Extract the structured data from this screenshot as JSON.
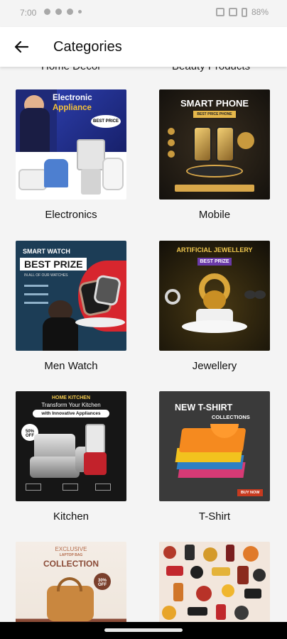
{
  "status": {
    "time": "7:00",
    "battery": "88%"
  },
  "appbar": {
    "title": "Categories"
  },
  "partial_top": [
    "Home Decor",
    "Beauty Products"
  ],
  "categories": [
    {
      "label": "Electronics",
      "banner": [
        "Electronic",
        "Appliance",
        "BEST PRICE"
      ]
    },
    {
      "label": "Mobile",
      "banner": [
        "SMART PHONE",
        "BEST PRICE PHONE"
      ]
    },
    {
      "label": "Men Watch",
      "banner": [
        "SMART WATCH",
        "BEST PRIZE",
        "IN ALL OF OUR WATCHES"
      ]
    },
    {
      "label": "Jewellery",
      "banner": [
        "ARTIFICIAL JEWELLERY",
        "BEST PRIZE"
      ]
    },
    {
      "label": "Kitchen",
      "banner": [
        "HOME KITCHEN",
        "Transform Your Kitchen",
        "with Innovative Appliances",
        "50% OFF"
      ]
    },
    {
      "label": "T-Shirt",
      "banner": [
        "NEW T-SHIRT",
        "COLLECTIONS",
        "BUY NOW"
      ]
    },
    {
      "label": "",
      "banner": [
        "EXCLUSIVE",
        "LAPTOP BAG",
        "COLLECTION",
        "30% OFF"
      ]
    },
    {
      "label": "",
      "banner": []
    }
  ]
}
